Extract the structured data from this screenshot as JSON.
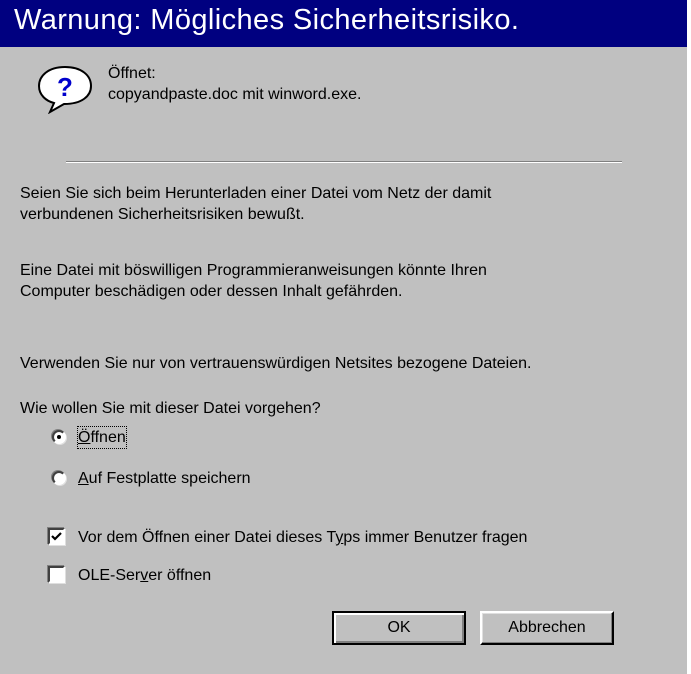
{
  "window": {
    "title": "Warnung: Mögliches Sicherheitsrisiko."
  },
  "header": {
    "icon": "question-icon",
    "opens_label": "Öffnet:",
    "file_line": "copyandpaste.doc mit winword.exe."
  },
  "body": {
    "para1_line1": "Seien Sie sich beim Herunterladen einer Datei vom Netz der damit",
    "para1_line2": "verbundenen Sicherheitsrisiken bewußt.",
    "para2_line1": "Eine Datei mit böswilligen Programmieranweisungen könnte Ihren",
    "para2_line2": "Computer beschädigen oder dessen Inhalt gefährden.",
    "para3": "Verwenden Sie nur von vertrauenswürdigen Netsites bezogene Dateien.",
    "question": "Wie wollen Sie mit dieser Datei vorgehen?"
  },
  "options": {
    "open": {
      "accel": "Ö",
      "rest": "ffnen",
      "selected": true
    },
    "save": {
      "accel": "A",
      "rest": "uf Festplatte speichern",
      "selected": false
    }
  },
  "checkboxes": {
    "ask": {
      "before": "Vor dem Öffnen einer Datei dieses T",
      "accel": "y",
      "after": "ps immer Benutzer fragen",
      "checked": true
    },
    "ole": {
      "before": "OLE-Ser",
      "accel": "v",
      "after": "er öffnen",
      "checked": false
    }
  },
  "buttons": {
    "ok": "OK",
    "cancel": "Abbrechen"
  },
  "colors": {
    "title_bar": "#000080",
    "face": "#c0c0c0",
    "icon_blue": "#0000cc"
  }
}
